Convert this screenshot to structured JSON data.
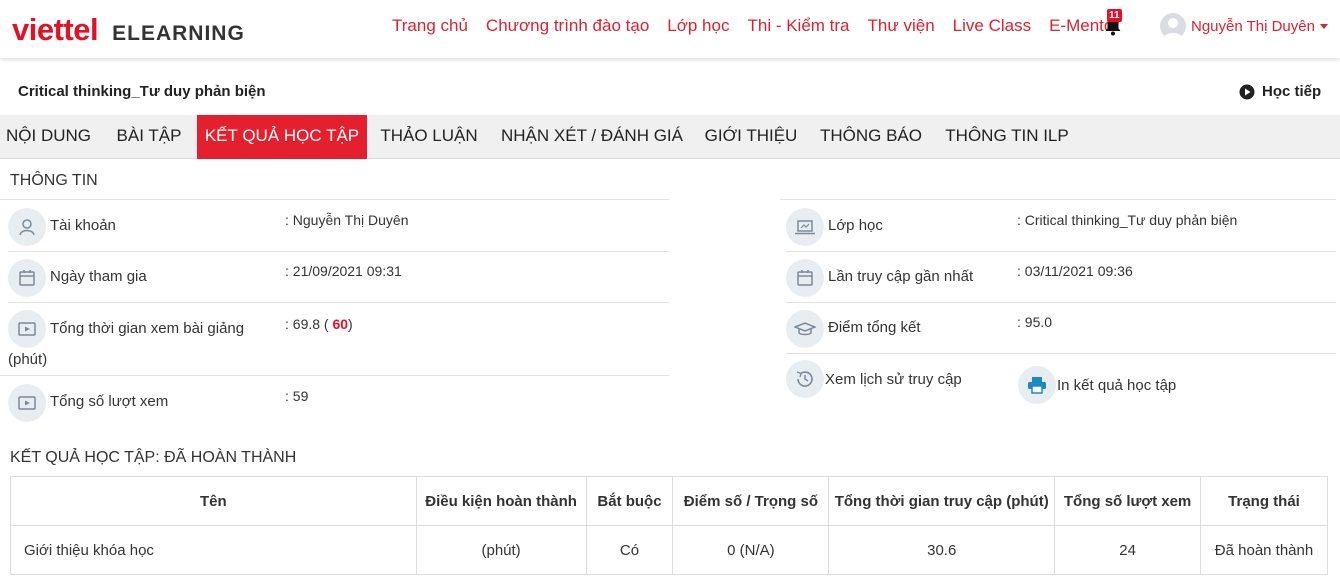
{
  "header": {
    "logo_main": "viettel",
    "logo_sub": "ELEARNING",
    "nav": [
      "Trang chủ",
      "Chương trình đào tạo",
      "Lớp học",
      "Thi - Kiểm tra",
      "Thư viện",
      "Live Class",
      "E-Mentor"
    ],
    "notification_count": "11",
    "user_name": "Nguyễn Thị Duyên",
    "brand_color": "#e60f23"
  },
  "course": {
    "title": "Critical thinking_Tư duy phản biện",
    "continue_label": "Học tiếp"
  },
  "tabs": [
    "NỘI DUNG",
    "BÀI TẬP",
    "KẾT QUẢ HỌC TẬP",
    "THẢO LUẬN",
    "NHẬN XÉT / ĐÁNH GIÁ",
    "GIỚI THIỆU",
    "THÔNG BÁO",
    "THÔNG TIN ILP"
  ],
  "active_tab": "KẾT QUẢ HỌC TẬP",
  "info": {
    "title": "THÔNG TIN",
    "account_label": "Tài khoản",
    "account_value": ": Nguyễn Thị Duyên",
    "join_label": "Ngày tham gia",
    "join_value": ": 21/09/2021 09:31",
    "watch_time_label": "Tổng thời gian xem bài giảng",
    "watch_time_unit": "(phút)",
    "watch_time_prefix": ": 69.8 ( ",
    "watch_time_required": "60",
    "watch_time_suffix": ")",
    "views_label": "Tổng số lượt xem",
    "views_value": ": 59",
    "class_label": "Lớp học",
    "class_value": ": Critical thinking_Tư duy phản biện",
    "last_access_label": "Lần truy cập gần nhất",
    "last_access_value": ": 03/11/2021 09:36",
    "score_label": "Điểm tổng kết",
    "score_value": ": 95.0",
    "history_link": "Xem lịch sử truy cập",
    "print_link": "In kết quả học tập"
  },
  "results": {
    "title": "KẾT QUẢ HỌC TẬP: ĐÃ HOÀN THÀNH",
    "columns": [
      "Tên",
      "Điều kiện hoàn thành",
      "Bắt buộc",
      "Điểm số / Trọng số",
      "Tổng thời gian truy cập (phút)",
      "Tổng số lượt xem",
      "Trạng thái"
    ],
    "rows": [
      [
        "Giới thiệu khóa học",
        "(phút)",
        "Có",
        "0 (N/A)",
        "30.6",
        "24",
        "Đã hoàn thành"
      ]
    ]
  }
}
